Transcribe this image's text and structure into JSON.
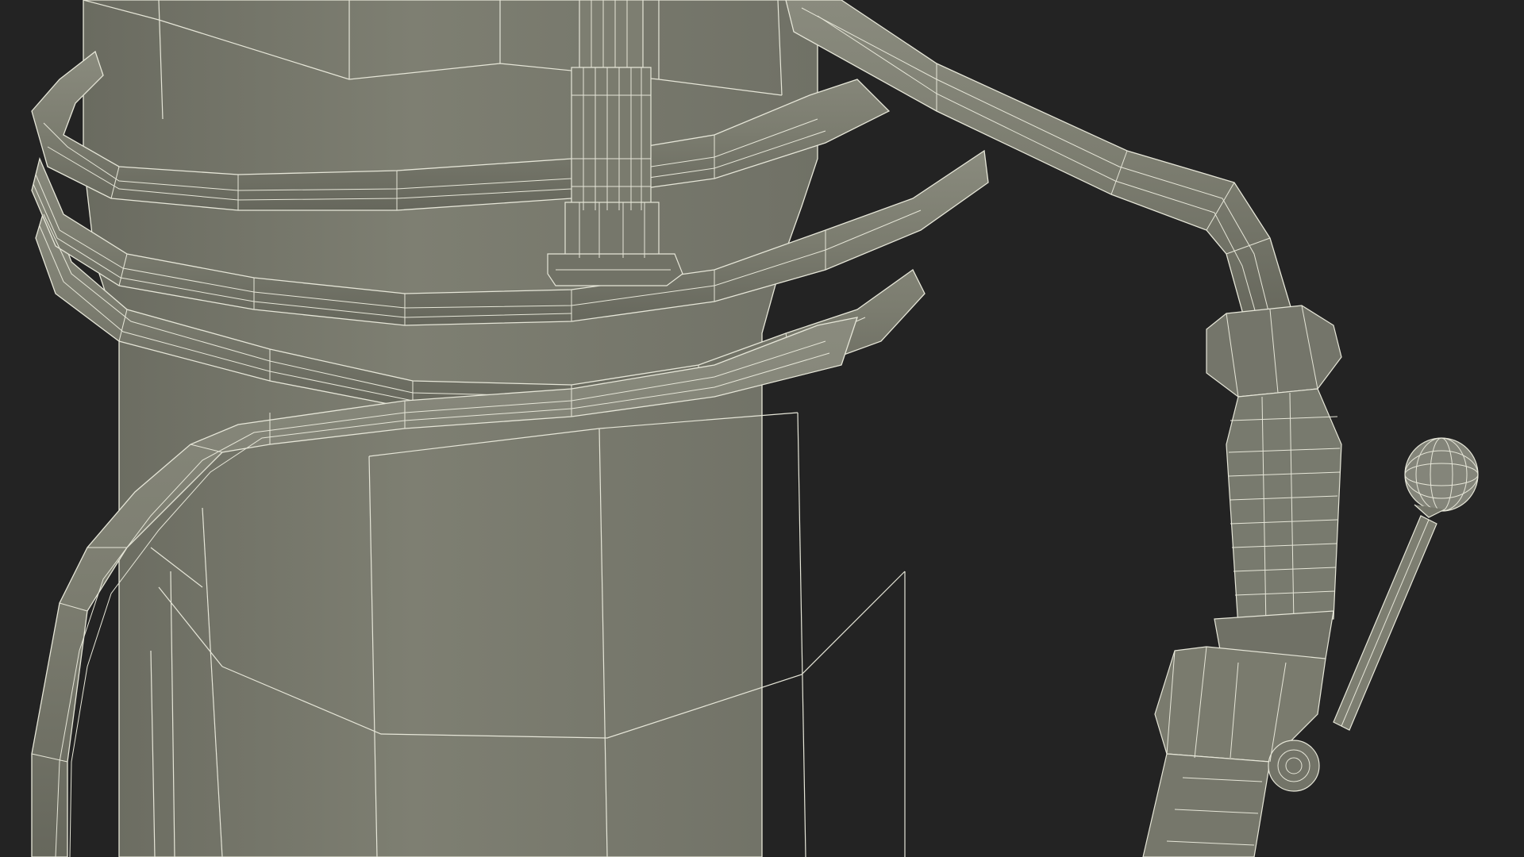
{
  "scene": {
    "colors": {
      "background": "#232323",
      "mesh_fill": "#7c7d70",
      "mesh_fill_dark": "#6a6b60",
      "mesh_fill_light": "#8a8b7e",
      "wire": "#e6e6d8"
    },
    "objects": [
      "tank-body",
      "coiled-hose",
      "spray-wand",
      "hose-fitting",
      "shutoff-valve",
      "valve-lever"
    ]
  }
}
